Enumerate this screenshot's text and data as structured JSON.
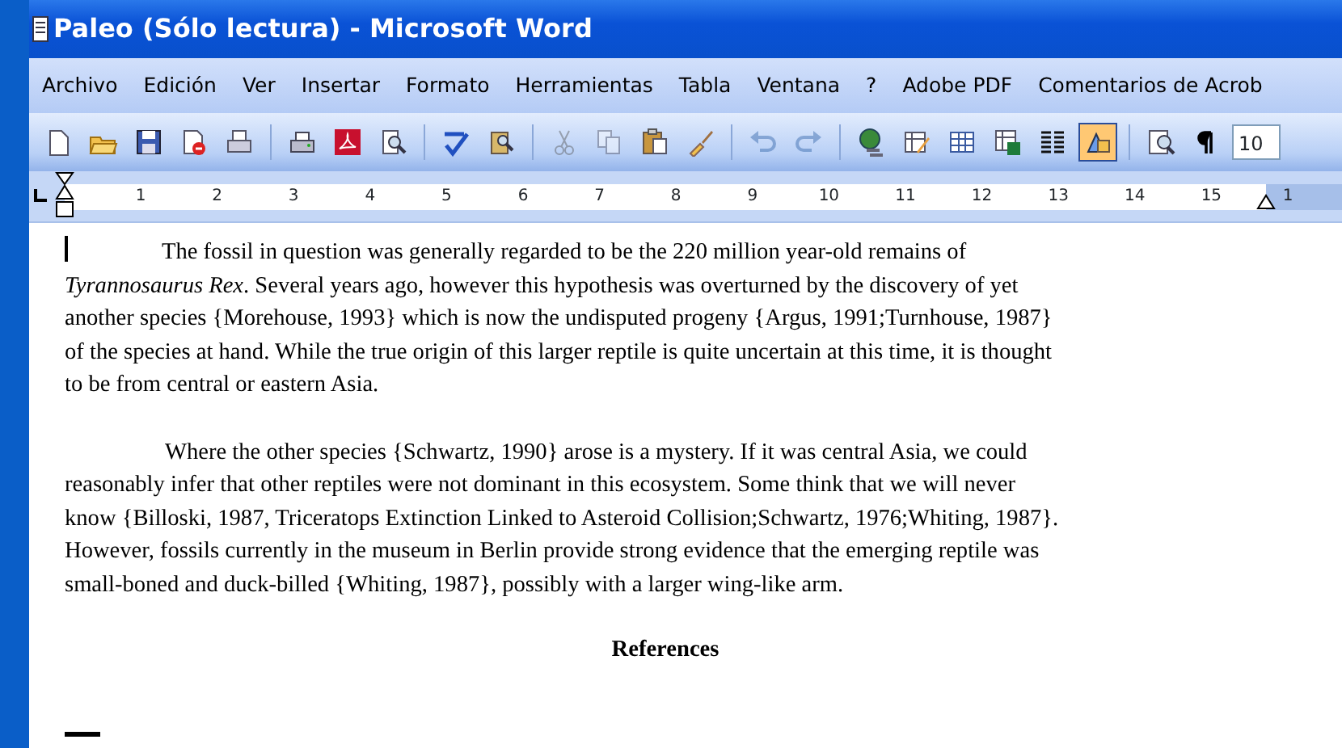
{
  "window": {
    "title": "Paleo (Sólo lectura) - Microsoft Word"
  },
  "menu": [
    "Archivo",
    "Edición",
    "Ver",
    "Insertar",
    "Formato",
    "Herramientas",
    "Tabla",
    "Ventana",
    "?",
    "Adobe PDF",
    "Comentarios de Acrob"
  ],
  "toolbar": [
    {
      "kind": "new",
      "disabled": false,
      "pressed": false
    },
    {
      "kind": "open",
      "disabled": false,
      "pressed": false
    },
    {
      "kind": "save",
      "disabled": false,
      "pressed": false
    },
    {
      "kind": "permission",
      "disabled": false,
      "pressed": false
    },
    {
      "kind": "email",
      "disabled": false,
      "pressed": false
    },
    {
      "kind": "sep"
    },
    {
      "kind": "print",
      "disabled": false,
      "pressed": false
    },
    {
      "kind": "pdf",
      "disabled": false,
      "pressed": false
    },
    {
      "kind": "preview",
      "disabled": false,
      "pressed": false
    },
    {
      "kind": "sep"
    },
    {
      "kind": "spelling",
      "disabled": false,
      "pressed": false
    },
    {
      "kind": "research",
      "disabled": false,
      "pressed": false
    },
    {
      "kind": "sep"
    },
    {
      "kind": "cut",
      "disabled": true,
      "pressed": false
    },
    {
      "kind": "copy",
      "disabled": true,
      "pressed": false
    },
    {
      "kind": "paste",
      "disabled": false,
      "pressed": false
    },
    {
      "kind": "brush",
      "disabled": false,
      "pressed": false
    },
    {
      "kind": "sep"
    },
    {
      "kind": "undo",
      "disabled": true,
      "pressed": false
    },
    {
      "kind": "redo",
      "disabled": true,
      "pressed": false
    },
    {
      "kind": "sep"
    },
    {
      "kind": "hyperlink",
      "disabled": false,
      "pressed": false
    },
    {
      "kind": "pencil-table",
      "disabled": false,
      "pressed": false
    },
    {
      "kind": "table",
      "disabled": false,
      "pressed": false
    },
    {
      "kind": "sheet",
      "disabled": false,
      "pressed": false
    },
    {
      "kind": "columns",
      "disabled": false,
      "pressed": false
    },
    {
      "kind": "drawing",
      "disabled": false,
      "pressed": true
    },
    {
      "kind": "sep"
    },
    {
      "kind": "docmap",
      "disabled": false,
      "pressed": false
    },
    {
      "kind": "pilcrow",
      "disabled": false,
      "pressed": false
    }
  ],
  "zoom_field": {
    "value": "10"
  },
  "ruler": {
    "labels": [
      "1",
      "2",
      "3",
      "4",
      "5",
      "6",
      "7",
      "8",
      "9",
      "10",
      "11",
      "12",
      "13",
      "14",
      "15",
      "1"
    ]
  },
  "document": {
    "paragraphs": [
      {
        "kind": "body",
        "lines": [
          "The fossil in question was generally regarded to be the 220 million year-old remains of",
          "*Tyrannosaurus Rex*.  Several years ago, however this hypothesis was overturned by the discovery of yet",
          "another species {Morehouse, 1993} which is now the undisputed progeny {Argus, 1991;Turnhouse, 1987}",
          "of the species at hand.  While the true origin of this larger reptile is quite uncertain at this time, it is thought",
          "to be from central or eastern Asia."
        ]
      },
      {
        "kind": "body",
        "lines": [
          "Where the other species {Schwartz, 1990} arose is a mystery.  If it was central Asia, we could",
          "reasonably infer that other reptiles were not dominant in this ecosystem.  Some think that we will never",
          "know {Billoski, 1987, Triceratops Extinction Linked to Asteroid Collision;Schwartz, 1976;Whiting, 1987}.",
          "However, fossils currently in the museum in Berlin provide strong evidence that the emerging reptile was",
          "small-boned and duck-billed {Whiting, 1987}, possibly with a larger wing-like arm."
        ]
      },
      {
        "kind": "heading",
        "lines": [
          "References"
        ]
      }
    ]
  }
}
